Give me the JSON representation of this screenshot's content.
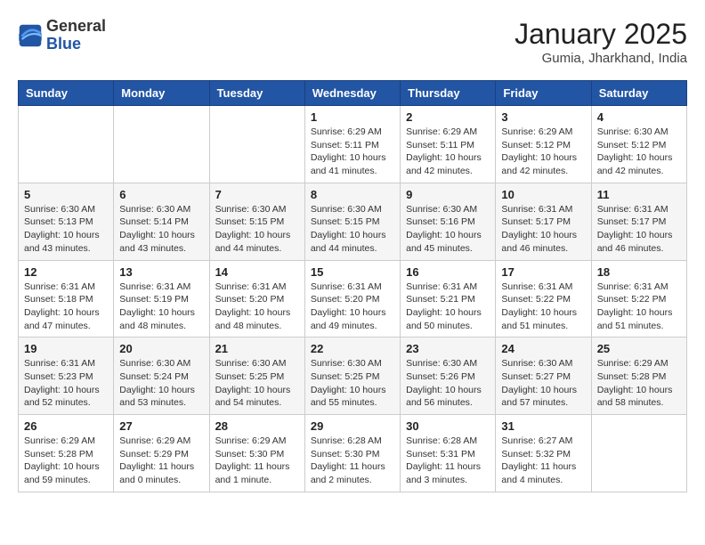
{
  "header": {
    "logo": {
      "line1": "General",
      "line2": "Blue"
    },
    "title": "January 2025",
    "subtitle": "Gumia, Jharkhand, India"
  },
  "weekdays": [
    "Sunday",
    "Monday",
    "Tuesday",
    "Wednesday",
    "Thursday",
    "Friday",
    "Saturday"
  ],
  "weeks": [
    [
      {
        "day": "",
        "info": ""
      },
      {
        "day": "",
        "info": ""
      },
      {
        "day": "",
        "info": ""
      },
      {
        "day": "1",
        "info": "Sunrise: 6:29 AM\nSunset: 5:11 PM\nDaylight: 10 hours\nand 41 minutes."
      },
      {
        "day": "2",
        "info": "Sunrise: 6:29 AM\nSunset: 5:11 PM\nDaylight: 10 hours\nand 42 minutes."
      },
      {
        "day": "3",
        "info": "Sunrise: 6:29 AM\nSunset: 5:12 PM\nDaylight: 10 hours\nand 42 minutes."
      },
      {
        "day": "4",
        "info": "Sunrise: 6:30 AM\nSunset: 5:12 PM\nDaylight: 10 hours\nand 42 minutes."
      }
    ],
    [
      {
        "day": "5",
        "info": "Sunrise: 6:30 AM\nSunset: 5:13 PM\nDaylight: 10 hours\nand 43 minutes."
      },
      {
        "day": "6",
        "info": "Sunrise: 6:30 AM\nSunset: 5:14 PM\nDaylight: 10 hours\nand 43 minutes."
      },
      {
        "day": "7",
        "info": "Sunrise: 6:30 AM\nSunset: 5:15 PM\nDaylight: 10 hours\nand 44 minutes."
      },
      {
        "day": "8",
        "info": "Sunrise: 6:30 AM\nSunset: 5:15 PM\nDaylight: 10 hours\nand 44 minutes."
      },
      {
        "day": "9",
        "info": "Sunrise: 6:30 AM\nSunset: 5:16 PM\nDaylight: 10 hours\nand 45 minutes."
      },
      {
        "day": "10",
        "info": "Sunrise: 6:31 AM\nSunset: 5:17 PM\nDaylight: 10 hours\nand 46 minutes."
      },
      {
        "day": "11",
        "info": "Sunrise: 6:31 AM\nSunset: 5:17 PM\nDaylight: 10 hours\nand 46 minutes."
      }
    ],
    [
      {
        "day": "12",
        "info": "Sunrise: 6:31 AM\nSunset: 5:18 PM\nDaylight: 10 hours\nand 47 minutes."
      },
      {
        "day": "13",
        "info": "Sunrise: 6:31 AM\nSunset: 5:19 PM\nDaylight: 10 hours\nand 48 minutes."
      },
      {
        "day": "14",
        "info": "Sunrise: 6:31 AM\nSunset: 5:20 PM\nDaylight: 10 hours\nand 48 minutes."
      },
      {
        "day": "15",
        "info": "Sunrise: 6:31 AM\nSunset: 5:20 PM\nDaylight: 10 hours\nand 49 minutes."
      },
      {
        "day": "16",
        "info": "Sunrise: 6:31 AM\nSunset: 5:21 PM\nDaylight: 10 hours\nand 50 minutes."
      },
      {
        "day": "17",
        "info": "Sunrise: 6:31 AM\nSunset: 5:22 PM\nDaylight: 10 hours\nand 51 minutes."
      },
      {
        "day": "18",
        "info": "Sunrise: 6:31 AM\nSunset: 5:22 PM\nDaylight: 10 hours\nand 51 minutes."
      }
    ],
    [
      {
        "day": "19",
        "info": "Sunrise: 6:31 AM\nSunset: 5:23 PM\nDaylight: 10 hours\nand 52 minutes."
      },
      {
        "day": "20",
        "info": "Sunrise: 6:30 AM\nSunset: 5:24 PM\nDaylight: 10 hours\nand 53 minutes."
      },
      {
        "day": "21",
        "info": "Sunrise: 6:30 AM\nSunset: 5:25 PM\nDaylight: 10 hours\nand 54 minutes."
      },
      {
        "day": "22",
        "info": "Sunrise: 6:30 AM\nSunset: 5:25 PM\nDaylight: 10 hours\nand 55 minutes."
      },
      {
        "day": "23",
        "info": "Sunrise: 6:30 AM\nSunset: 5:26 PM\nDaylight: 10 hours\nand 56 minutes."
      },
      {
        "day": "24",
        "info": "Sunrise: 6:30 AM\nSunset: 5:27 PM\nDaylight: 10 hours\nand 57 minutes."
      },
      {
        "day": "25",
        "info": "Sunrise: 6:29 AM\nSunset: 5:28 PM\nDaylight: 10 hours\nand 58 minutes."
      }
    ],
    [
      {
        "day": "26",
        "info": "Sunrise: 6:29 AM\nSunset: 5:28 PM\nDaylight: 10 hours\nand 59 minutes."
      },
      {
        "day": "27",
        "info": "Sunrise: 6:29 AM\nSunset: 5:29 PM\nDaylight: 11 hours\nand 0 minutes."
      },
      {
        "day": "28",
        "info": "Sunrise: 6:29 AM\nSunset: 5:30 PM\nDaylight: 11 hours\nand 1 minute."
      },
      {
        "day": "29",
        "info": "Sunrise: 6:28 AM\nSunset: 5:30 PM\nDaylight: 11 hours\nand 2 minutes."
      },
      {
        "day": "30",
        "info": "Sunrise: 6:28 AM\nSunset: 5:31 PM\nDaylight: 11 hours\nand 3 minutes."
      },
      {
        "day": "31",
        "info": "Sunrise: 6:27 AM\nSunset: 5:32 PM\nDaylight: 11 hours\nand 4 minutes."
      },
      {
        "day": "",
        "info": ""
      }
    ]
  ]
}
